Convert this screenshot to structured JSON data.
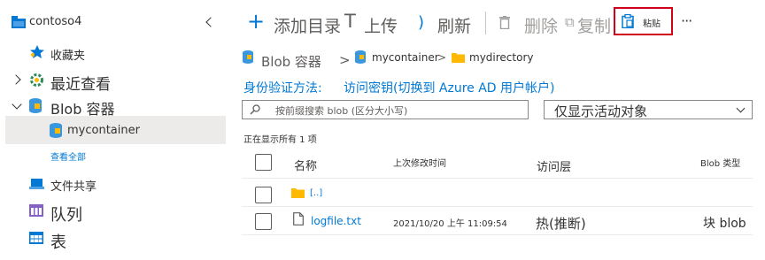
{
  "sidebar": {
    "account": "contoso4",
    "favorites": "收藏夹",
    "recent": "最近查看",
    "blob_containers": "Blob 容器",
    "container": "mycontainer",
    "view_all": "查看全部",
    "file_shares": "文件共享",
    "queues": "队列",
    "tables": "表"
  },
  "toolbar": {
    "add_directory": "添加目录",
    "upload": "上传",
    "refresh": "刷新",
    "delete": "删除",
    "copy": "复制",
    "paste": "粘贴",
    "more": "···"
  },
  "breadcrumb": {
    "root": "Blob 容器",
    "separator": ">",
    "container": "mycontainer",
    "directory": "mydirectory"
  },
  "auth": {
    "label": "身份验证方法:",
    "value": "访问密钥(切换到 Azure AD 用户帐户)"
  },
  "filters": {
    "search_placeholder": "按前缀搜索 blob (区分大小写)",
    "view_option": "仅显示活动对象"
  },
  "status": "正在显示所有 1 项",
  "table": {
    "headers": [
      "名称",
      "上次修改时间",
      "访问层",
      "Blob 类型"
    ],
    "rows": [
      {
        "name": "[..]",
        "modified": "",
        "tier": "",
        "type": ""
      },
      {
        "name": "logfile.txt",
        "modified": "2021/10/20 上午 11:09:54",
        "tier": "热(推断)",
        "type": "块 blob"
      }
    ]
  },
  "colors": {
    "accent": "#0078d4",
    "highlight_box": "#d0021b",
    "folder": "#ffb900"
  }
}
